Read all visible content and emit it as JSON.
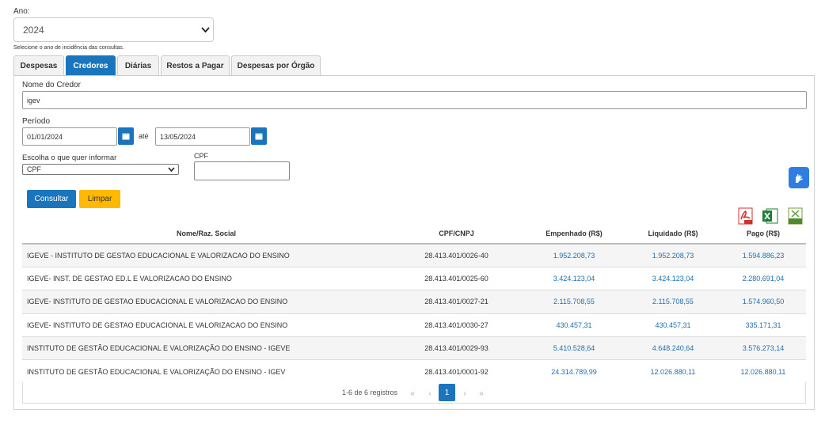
{
  "year_filter": {
    "label": "Ano:",
    "selected": "2024",
    "hint": "Selecione o ano de incidência das consultas."
  },
  "tabs": [
    {
      "label": "Despesas"
    },
    {
      "label": "Credores"
    },
    {
      "label": "Diárias"
    },
    {
      "label": "Restos a Pagar"
    },
    {
      "label": "Despesas por Órgão"
    }
  ],
  "form": {
    "credor_label": "Nome do Credor",
    "credor_value": "igev",
    "periodo_label": "Período",
    "date_from": "01/01/2024",
    "ate_label": "até",
    "date_to": "13/05/2024",
    "choose_label": "Escolha o que quer informar",
    "choose_selected": "CPF",
    "cpf_label": "CPF",
    "cpf_value": "",
    "consultar": "Consultar",
    "limpar": "Limpar"
  },
  "export_icons": [
    "pdf-icon",
    "excel-icon",
    "csv-icon"
  ],
  "colors": {
    "primary": "#1b75bc",
    "limpar": "#ffb900",
    "link": "#1f6fb2"
  },
  "table": {
    "headers": [
      "Nome/Raz. Social",
      "CPF/CNPJ",
      "Empenhado (R$)",
      "Liquidado (R$)",
      "Pago (R$)"
    ],
    "rows": [
      {
        "nome": "IGEVE - INSTITUTO DE GESTAO EDUCACIONAL E VALORIZACAO DO ENSINO",
        "doc": "28.413.401/0026-40",
        "empenhado": "1.952.208,73",
        "liquidado": "1.952.208,73",
        "pago": "1.594.886,23"
      },
      {
        "nome": "IGEVE- INST. DE GESTAO ED.L E VALORIZACAO DO ENSINO",
        "doc": "28.413.401/0025-60",
        "empenhado": "3.424.123,04",
        "liquidado": "3.424.123,04",
        "pago": "2.280.691,04"
      },
      {
        "nome": "IGEVE- INSTITUTO DE GESTAO EDUCACIONAL E VALORIZACAO DO ENSINO",
        "doc": "28.413.401/0027-21",
        "empenhado": "2.115.708,55",
        "liquidado": "2.115.708,55",
        "pago": "1.574.960,50"
      },
      {
        "nome": "IGEVE- INSTITUTO DE GESTAO EDUCACIONAL E VALORIZACAO DO ENSINO",
        "doc": "28.413.401/0030-27",
        "empenhado": "430.457,31",
        "liquidado": "430.457,31",
        "pago": "335.171,31"
      },
      {
        "nome": "INSTITUTO DE GESTÃO EDUCACIONAL E VALORIZAÇÃO DO ENSINO - IGEVE",
        "doc": "28.413.401/0029-93",
        "empenhado": "5.410.528,64",
        "liquidado": "4.648.240,64",
        "pago": "3.576.273,14"
      },
      {
        "nome": "INSTITUTO DE GESTÃO EDUCACIONAL E VALORIZAÇÃO DO ENSINO - IGEV",
        "doc": "28.413.401/0001-92",
        "empenhado": "24.314.789,99",
        "liquidado": "12.026.880,11",
        "pago": "12.026.880,11"
      }
    ]
  },
  "pagination": {
    "info": "1-6 de 6 registros",
    "first": "«",
    "prev": "‹",
    "current": "1",
    "next": "›",
    "last": "»"
  }
}
